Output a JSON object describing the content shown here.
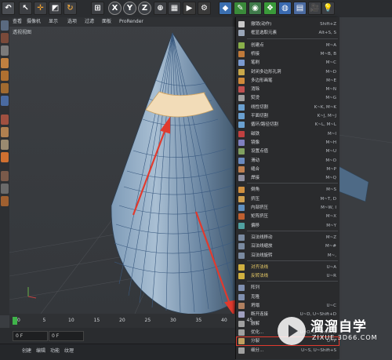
{
  "toolbar": {
    "axes": [
      "X",
      "Y",
      "Z"
    ]
  },
  "viewport": {
    "menu": [
      "查看",
      "摄像机",
      "显示",
      "选项",
      "过滤",
      "面板",
      "ProRender"
    ],
    "title": "透视视图"
  },
  "context_menu": {
    "items": [
      {
        "label": "撤销(动作)",
        "shortcut": "Shift+Z",
        "color": "#c9c9c9",
        "highlight": false
      },
      {
        "label": "框显选取元素",
        "shortcut": "Alt+S, S",
        "color": "#9aa6b8",
        "highlight": false
      },
      {
        "label": "创建点",
        "shortcut": "M~A",
        "color": "#8ab04a",
        "highlight": false
      },
      {
        "label": "桥接",
        "shortcut": "M~B, B",
        "color": "#c07a3a",
        "highlight": false
      },
      {
        "label": "笔刷",
        "shortcut": "M~C",
        "color": "#7a9ad0",
        "highlight": false
      },
      {
        "label": "封闭多边形孔洞",
        "shortcut": "M~D",
        "color": "#c9a84a",
        "highlight": false
      },
      {
        "label": "多边形画笔",
        "shortcut": "M~E",
        "color": "#d08a3a",
        "highlight": false
      },
      {
        "label": "消除",
        "shortcut": "M~N",
        "color": "#c05050",
        "highlight": false
      },
      {
        "label": "熨烫",
        "shortcut": "M~G",
        "color": "#a0a0a0",
        "highlight": false
      },
      {
        "label": "线性切割",
        "shortcut": "K~K, M~K",
        "color": "#6aa0d0",
        "highlight": false
      },
      {
        "label": "平面切割",
        "shortcut": "K~J, M~J",
        "color": "#6aa0d0",
        "highlight": false
      },
      {
        "label": "循环/路径切割",
        "shortcut": "K~L, M~L",
        "color": "#6aa0d0",
        "highlight": false
      },
      {
        "label": "磁铁",
        "shortcut": "M~I",
        "color": "#c04040",
        "highlight": false
      },
      {
        "label": "镜像",
        "shortcut": "M~H",
        "color": "#8080c0",
        "highlight": false
      },
      {
        "label": "设置点值",
        "shortcut": "M~U",
        "color": "#80a060",
        "highlight": false
      },
      {
        "label": "滑动",
        "shortcut": "M~O",
        "color": "#6a8ac0",
        "highlight": false
      },
      {
        "label": "缝合",
        "shortcut": "M~P",
        "color": "#c08050",
        "highlight": false
      },
      {
        "label": "焊接",
        "shortcut": "M~Q",
        "color": "#9090a0",
        "highlight": false
      },
      {
        "label": "倒角",
        "shortcut": "M~S",
        "color": "#d09040",
        "highlight": false
      },
      {
        "label": "挤压",
        "shortcut": "M~T, D",
        "color": "#d0a050",
        "highlight": false
      },
      {
        "label": "内部挤压",
        "shortcut": "M~W, I",
        "color": "#6090c0",
        "highlight": false
      },
      {
        "label": "矩阵挤压",
        "shortcut": "M~X",
        "color": "#c06030",
        "highlight": false
      },
      {
        "label": "偏移",
        "shortcut": "M~Y",
        "color": "#50a0a0",
        "highlight": false
      },
      {
        "label": "沿法线移动",
        "shortcut": "M~Z",
        "color": "#7a8aa0",
        "highlight": false
      },
      {
        "label": "沿法线缩放",
        "shortcut": "M~#",
        "color": "#7a8aa0",
        "highlight": false
      },
      {
        "label": "沿法线旋转",
        "shortcut": "M~,",
        "color": "#7a8aa0",
        "highlight": false
      },
      {
        "label": "对齐法线",
        "shortcut": "U~A",
        "color": "#d0b040",
        "highlight": true
      },
      {
        "label": "反转法线",
        "shortcut": "U~R",
        "color": "#d0b040",
        "highlight": true
      },
      {
        "label": "阵列",
        "shortcut": "",
        "color": "#8090b0",
        "highlight": false
      },
      {
        "label": "克隆",
        "shortcut": "",
        "color": "#8090b0",
        "highlight": false
      },
      {
        "label": "坍塌",
        "shortcut": "U~C",
        "color": "#b08060",
        "highlight": false
      },
      {
        "label": "断开连接",
        "shortcut": "U~D, U~Shift+D",
        "color": "#a0a0c0",
        "highlight": false
      },
      {
        "label": "融解",
        "shortcut": "",
        "color": "#a0a0a0",
        "highlight": false
      },
      {
        "label": "优化...",
        "shortcut": "U~O, U~Shift+O",
        "color": "#a0a0a0",
        "highlight": false
      },
      {
        "label": "分裂",
        "shortcut": "U~P",
        "color": "#c0a060",
        "highlight": false
      },
      {
        "label": "细分...",
        "shortcut": "U~S, U~Shift+S",
        "color": "#a0a0a0",
        "highlight": false
      }
    ]
  },
  "timeline": {
    "ticks": [
      "0",
      "5",
      "10",
      "15",
      "20",
      "25",
      "30",
      "35",
      "40",
      "45"
    ],
    "field_start": "0 F",
    "field_end": "0 F"
  },
  "bottom_tabs": [
    "创建",
    "编辑",
    "功能",
    "纹理"
  ],
  "watermark": {
    "name": "溜溜自学",
    "url": "ZIXUE.3D66.COM"
  },
  "colors": {
    "accent_red": "#e03a2e",
    "selection_band": "#f2dcb8",
    "mesh": "#6a8fb4"
  }
}
